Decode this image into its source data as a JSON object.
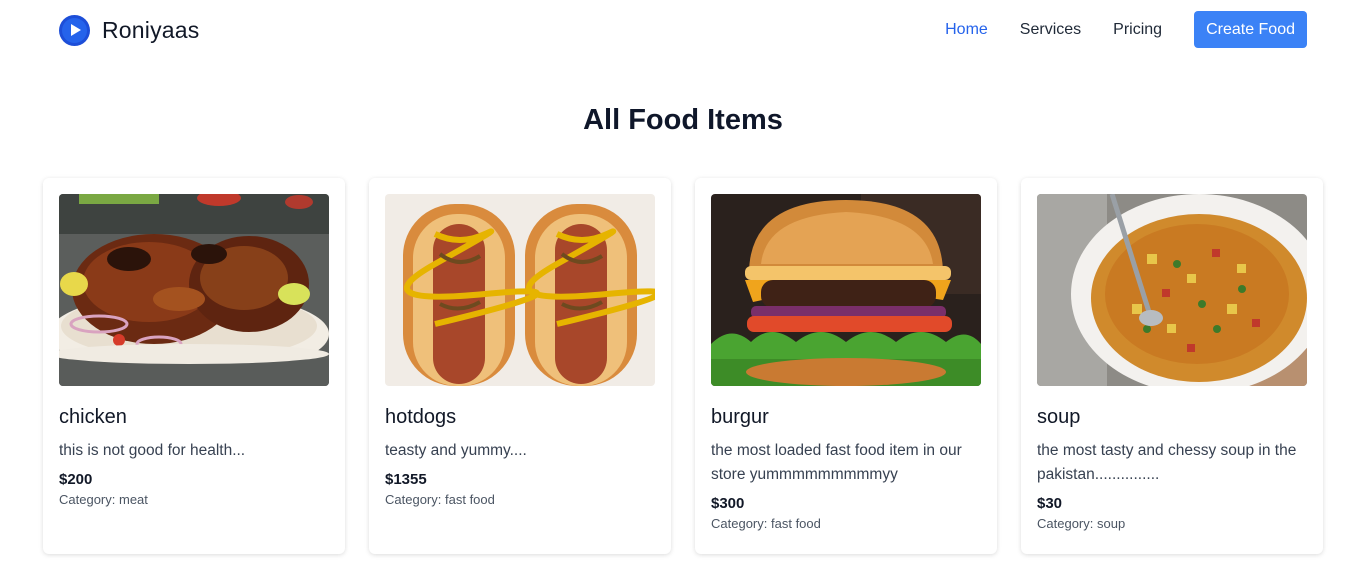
{
  "brand": {
    "name": "Roniyaas",
    "logo_icon": "play-circle-icon"
  },
  "nav": {
    "links": [
      {
        "label": "Home",
        "active": true
      },
      {
        "label": "Services",
        "active": false
      },
      {
        "label": "Pricing",
        "active": false
      }
    ],
    "cta_label": "Create Food"
  },
  "page": {
    "title": "All Food Items"
  },
  "colors": {
    "accent": "#3b82f6",
    "active_link": "#2563eb"
  },
  "foods": [
    {
      "name": "chicken",
      "description": "this is not good for health...",
      "price": "$200",
      "category_label": "Category:",
      "category": "meat",
      "image": "grilled-chicken-photo"
    },
    {
      "name": "hotdogs",
      "description": "teasty and yummy....",
      "price": "$1355",
      "category_label": "Category:",
      "category": "fast food",
      "image": "hotdogs-photo"
    },
    {
      "name": "burgur",
      "description": "the most loaded fast food item in our store yummmmmmmmmyy",
      "price": "$300",
      "category_label": "Category:",
      "category": "fast food",
      "image": "burger-photo"
    },
    {
      "name": "soup",
      "description": "the most tasty and chessy soup in the pakistan...............",
      "price": "$30",
      "category_label": "Category:",
      "category": "soup",
      "image": "vegetable-soup-photo"
    }
  ]
}
